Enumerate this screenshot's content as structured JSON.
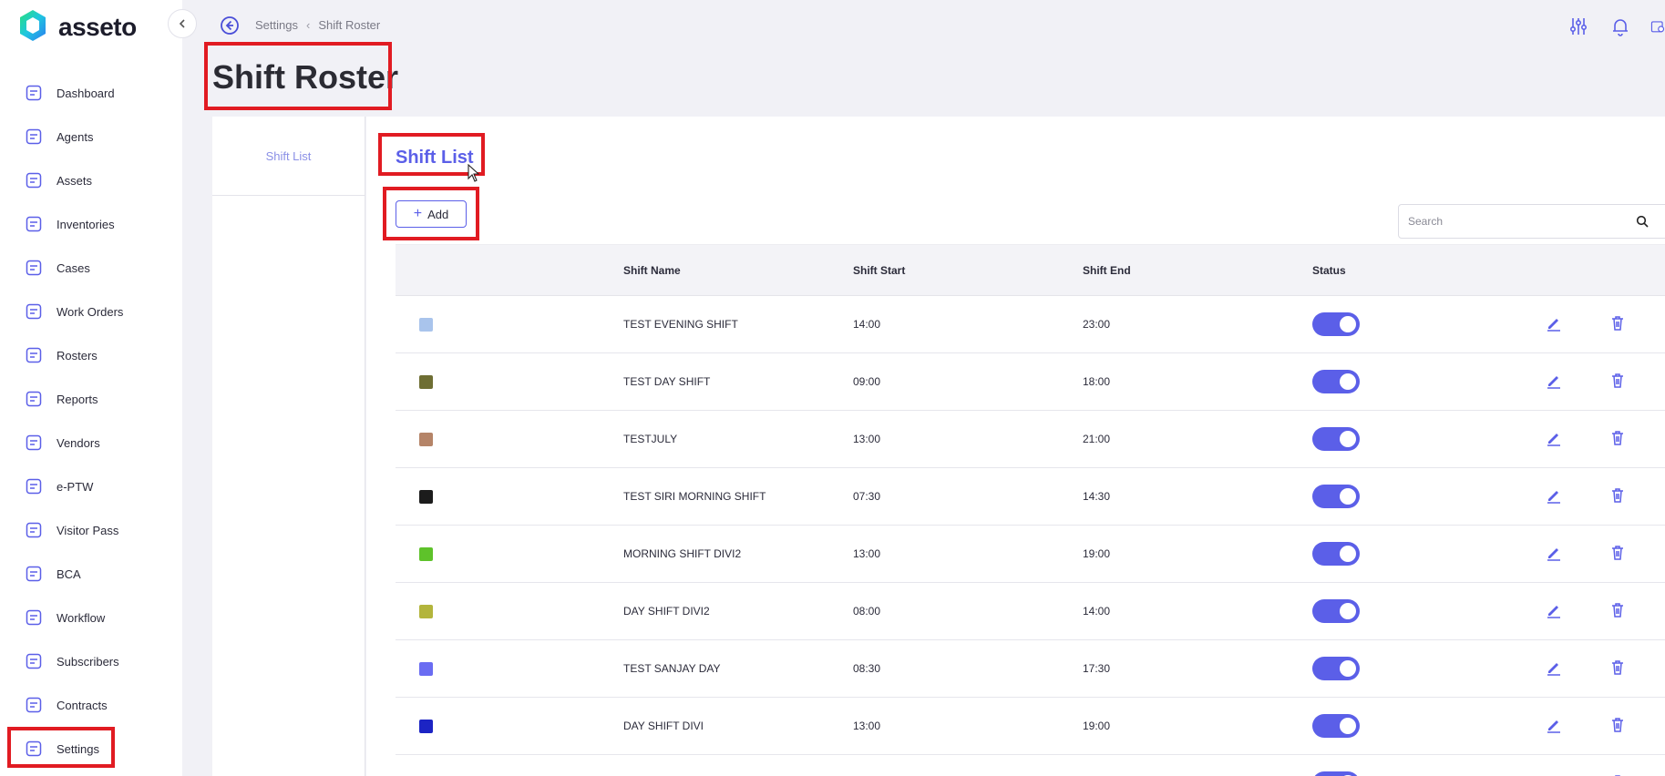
{
  "app": {
    "brand": "asseto",
    "accent": "#5b5fe8",
    "highlight": "#e11b22"
  },
  "sidebar": {
    "items": [
      {
        "label": "Dashboard",
        "icon": "dashboard-icon"
      },
      {
        "label": "Agents",
        "icon": "agents-icon"
      },
      {
        "label": "Assets",
        "icon": "assets-icon"
      },
      {
        "label": "Inventories",
        "icon": "inventories-icon"
      },
      {
        "label": "Cases",
        "icon": "cases-icon"
      },
      {
        "label": "Work Orders",
        "icon": "work-orders-icon"
      },
      {
        "label": "Rosters",
        "icon": "rosters-icon"
      },
      {
        "label": "Reports",
        "icon": "reports-icon"
      },
      {
        "label": "Vendors",
        "icon": "vendors-icon"
      },
      {
        "label": "e-PTW",
        "icon": "eptw-icon"
      },
      {
        "label": "Visitor Pass",
        "icon": "visitor-pass-icon"
      },
      {
        "label": "BCA",
        "icon": "bca-icon"
      },
      {
        "label": "Workflow",
        "icon": "workflow-icon"
      },
      {
        "label": "Subscribers",
        "icon": "subscribers-icon"
      },
      {
        "label": "Contracts",
        "icon": "contracts-icon"
      },
      {
        "label": "Settings",
        "icon": "settings-icon",
        "active": true
      }
    ]
  },
  "breadcrumb": {
    "parent": "Settings",
    "current": "Shift Roster"
  },
  "page": {
    "title": "Shift Roster"
  },
  "tabs": [
    {
      "label": "Shift List"
    }
  ],
  "main": {
    "section_title": "Shift List",
    "add_label": "Add",
    "search_placeholder": "Search"
  },
  "table": {
    "headers": {
      "name": "Shift Name",
      "start": "Shift Start",
      "end": "Shift End",
      "status": "Status"
    },
    "rows": [
      {
        "color": "#a9c4ec",
        "name": "TEST EVENING SHIFT",
        "start": "14:00",
        "end": "23:00",
        "active": true
      },
      {
        "color": "#6e6e33",
        "name": "TEST DAY SHIFT",
        "start": "09:00",
        "end": "18:00",
        "active": true
      },
      {
        "color": "#b58468",
        "name": "TESTJULY",
        "start": "13:00",
        "end": "21:00",
        "active": true
      },
      {
        "color": "#1c1c1c",
        "name": "TEST SIRI MORNING SHIFT",
        "start": "07:30",
        "end": "14:30",
        "active": true
      },
      {
        "color": "#5ec22a",
        "name": "MORNING SHIFT DIVI2",
        "start": "13:00",
        "end": "19:00",
        "active": true
      },
      {
        "color": "#b3b53c",
        "name": "DAY SHIFT DIVI2",
        "start": "08:00",
        "end": "14:00",
        "active": true
      },
      {
        "color": "#6a6cf2",
        "name": "TEST SANJAY DAY",
        "start": "08:30",
        "end": "17:30",
        "active": true
      },
      {
        "color": "#1c24c4",
        "name": "DAY SHIFT DIVI",
        "start": "13:00",
        "end": "19:00",
        "active": true
      },
      {
        "color": "#ffffff",
        "name": "",
        "start": "",
        "end": "",
        "active": true
      }
    ]
  }
}
